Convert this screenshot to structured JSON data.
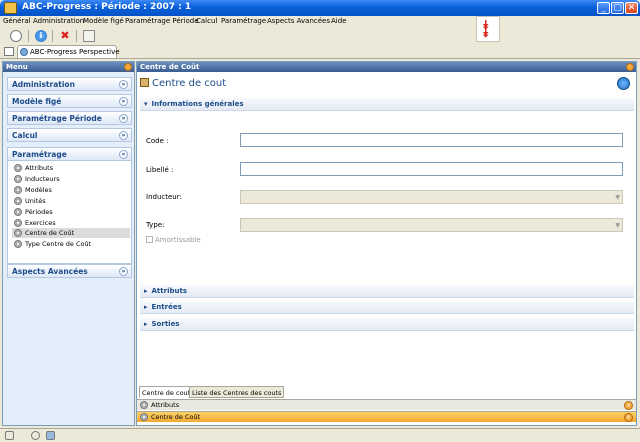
{
  "window": {
    "title": "ABC-Progress : Période : 2007 : 1"
  },
  "menubar": {
    "items": [
      "Général",
      "Administration",
      "Modèle figé",
      "Paramétrage Période",
      "Calcul",
      "Paramétrage",
      "Aspects Avancées",
      "Aide"
    ]
  },
  "toolbar": {
    "icons": [
      "search-icon",
      "info-icon",
      "delete-icon",
      "document-icon"
    ]
  },
  "perspective": {
    "tab_label": "ABC-Progress Perspective"
  },
  "left_panel": {
    "title": "Menu",
    "groups": [
      "Administration",
      "Modèle figé",
      "Paramétrage Période",
      "Calcul",
      "Paramétrage",
      "Aspects Avancées"
    ],
    "expanded_group": "Paramétrage",
    "items": [
      "Attributs",
      "Inducteurs",
      "Modèles",
      "Unités",
      "Périodes",
      "Exercices",
      "Centre de Coût",
      "Type Centre de Coût"
    ],
    "selected_item": "Centre de Coût"
  },
  "right_panel": {
    "title": "Centre de Coût",
    "breadcrumb": "Centre de cout",
    "sections": {
      "general": "Informations générales",
      "attributs": "Attributs",
      "entrees": "Entrées",
      "sorties": "Sorties"
    },
    "fields": {
      "code": {
        "label": "Code :",
        "value": ""
      },
      "libelle": {
        "label": "Libellé :",
        "value": ""
      },
      "inducteur": {
        "label": "Inducteur:",
        "value": ""
      },
      "type": {
        "label": "Type:",
        "value": ""
      }
    },
    "checkbox_label": "Amortissable",
    "bottom_tabs": [
      "Centre de cout",
      "Liste des Centres des couts"
    ],
    "bottom_bars": [
      "Attributs",
      "Centre de Coût"
    ]
  },
  "colors": {
    "accent": "#1d4c8a",
    "titlebar": "#0a5fd8",
    "highlight": "#f5b72e"
  }
}
